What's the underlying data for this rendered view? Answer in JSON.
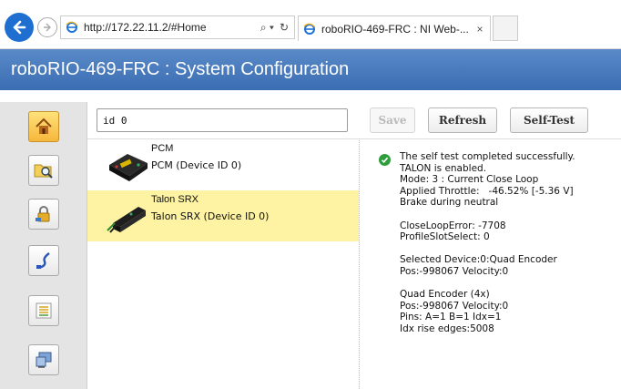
{
  "browser": {
    "address": "http://172.22.11.2/#Home",
    "tab_title": "roboRIO-469-FRC : NI Web-...",
    "tab_close": "×",
    "search_glyph": "⌕ ▾",
    "refresh_glyph": "↻"
  },
  "app": {
    "title": "roboRIO-469-FRC : System Configuration"
  },
  "rail": {
    "items": [
      {
        "icon": "home-icon"
      },
      {
        "icon": "folder-search-icon"
      },
      {
        "icon": "lock-icon"
      },
      {
        "icon": "network-cable-icon"
      },
      {
        "icon": "list-icon"
      },
      {
        "icon": "monitor-icon"
      }
    ]
  },
  "search": {
    "value": "id 0"
  },
  "devices": [
    {
      "name": "PCM",
      "subtitle": "PCM (Device ID 0)"
    },
    {
      "name": "Talon SRX",
      "subtitle": "Talon SRX (Device ID 0)"
    }
  ],
  "toolbar": {
    "save_label": "Save",
    "refresh_label": "Refresh",
    "selftest_label": "Self-Test"
  },
  "self_test": {
    "lines": [
      "The self test completed successfully.",
      "TALON is enabled.",
      "Mode: 3 : Current Close Loop",
      "Applied Throttle:   -46.52% [-5.36 V]",
      "Brake during neutral",
      "",
      "CloseLoopError: -7708",
      "ProfileSlotSelect: 0",
      "",
      "Selected Device:0:Quad Encoder",
      "Pos:-998067 Velocity:0",
      "",
      "Quad Encoder (4x)",
      "Pos:-998067 Velocity:0",
      "Pins: A=1 B=1 Idx=1",
      "Idx rise edges:5008"
    ]
  },
  "colors": {
    "header": "#4a7cc0",
    "selected_row": "#fdf3a3",
    "success": "#2e9e3c"
  }
}
